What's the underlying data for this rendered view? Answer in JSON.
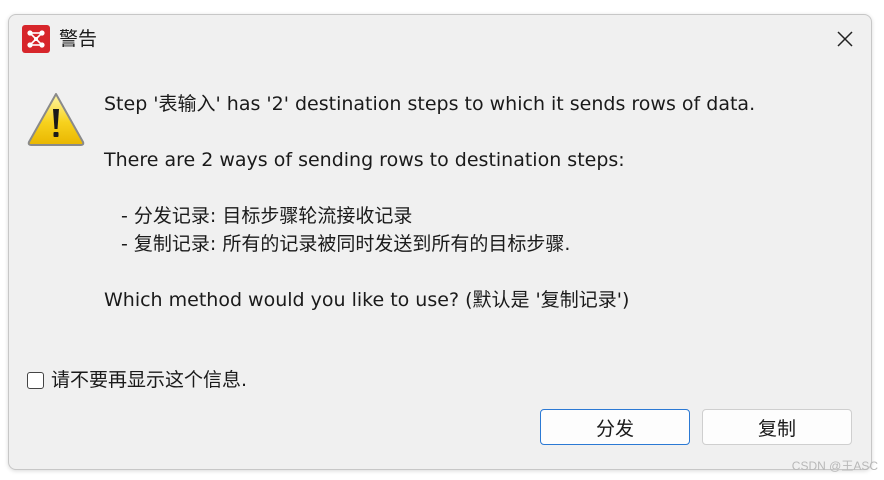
{
  "window": {
    "title": "警告",
    "app_icon": "app-logo-icon",
    "close_icon": "close-icon"
  },
  "message": {
    "icon": "warning-icon",
    "line1": "Step '表输入' has '2' destination steps to which it sends rows of data.",
    "line2": "There are 2 ways of sending rows to destination steps:",
    "line3": "- 分发记录: 目标步骤轮流接收记录",
    "line4": "- 复制记录: 所有的记录被同时发送到所有的目标步骤.",
    "line5": "Which method would you like to use? (默认是 '复制记录')"
  },
  "dont_show": {
    "label": "请不要再显示这个信息.",
    "checked": false
  },
  "buttons": {
    "distribute": "分发",
    "copy": "复制"
  },
  "watermark": "CSDN @王ASC",
  "colors": {
    "app_icon_bg": "#d7262b",
    "primary_border": "#2b79d4",
    "dialog_bg": "#f0f0f0"
  }
}
